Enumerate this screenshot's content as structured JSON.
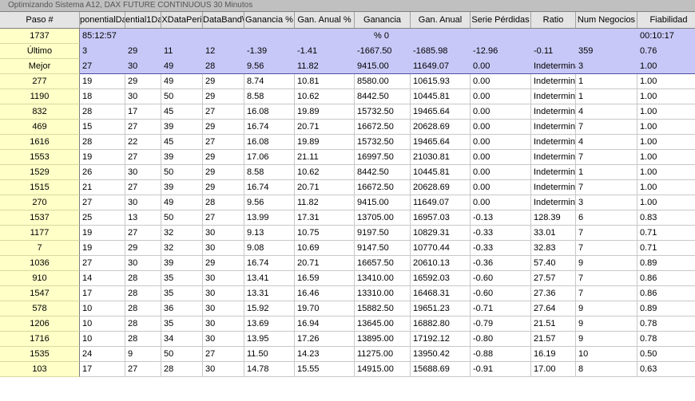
{
  "window": {
    "title": "Optimizando Sistema A12, DAX FUTURE CONTINUOUS 30 Minutos"
  },
  "headers": [
    "Paso #",
    "ponentialData",
    "ential1Da",
    "XDataPeri",
    "DataBand\\",
    "Ganancia %",
    "Gan. Anual %",
    "Ganancia",
    "Gan. Anual",
    "Serie Pérdidas",
    "Ratio",
    "Num Negocios",
    "Fiabilidad"
  ],
  "progress": {
    "label": "1737",
    "elapsed": "85:12:57",
    "percent": "% 0",
    "remaining": "00:10:17"
  },
  "summary": [
    {
      "label": "Último",
      "cells": [
        "3",
        "29",
        "11",
        "12",
        "-1.39",
        "-1.41",
        "-1667.50",
        "-1685.98",
        "-12.96",
        "-0.11",
        "359",
        "0.76"
      ]
    },
    {
      "label": "Mejor",
      "cells": [
        "27",
        "30",
        "49",
        "28",
        "9.56",
        "11.82",
        "9415.00",
        "11649.07",
        "0.00",
        "Indetermina",
        "3",
        "1.00"
      ]
    }
  ],
  "rows": [
    [
      "277",
      "19",
      "29",
      "49",
      "29",
      "8.74",
      "10.81",
      "8580.00",
      "10615.93",
      "0.00",
      "Indetermina",
      "1",
      "1.00"
    ],
    [
      "1190",
      "18",
      "30",
      "50",
      "29",
      "8.58",
      "10.62",
      "8442.50",
      "10445.81",
      "0.00",
      "Indetermina",
      "1",
      "1.00"
    ],
    [
      "832",
      "28",
      "17",
      "45",
      "27",
      "16.08",
      "19.89",
      "15732.50",
      "19465.64",
      "0.00",
      "Indetermina",
      "4",
      "1.00"
    ],
    [
      "469",
      "15",
      "27",
      "39",
      "29",
      "16.74",
      "20.71",
      "16672.50",
      "20628.69",
      "0.00",
      "Indetermina",
      "7",
      "1.00"
    ],
    [
      "1616",
      "28",
      "22",
      "45",
      "27",
      "16.08",
      "19.89",
      "15732.50",
      "19465.64",
      "0.00",
      "Indetermina",
      "4",
      "1.00"
    ],
    [
      "1553",
      "19",
      "27",
      "39",
      "29",
      "17.06",
      "21.11",
      "16997.50",
      "21030.81",
      "0.00",
      "Indetermina",
      "7",
      "1.00"
    ],
    [
      "1529",
      "26",
      "30",
      "50",
      "29",
      "8.58",
      "10.62",
      "8442.50",
      "10445.81",
      "0.00",
      "Indetermina",
      "1",
      "1.00"
    ],
    [
      "1515",
      "21",
      "27",
      "39",
      "29",
      "16.74",
      "20.71",
      "16672.50",
      "20628.69",
      "0.00",
      "Indetermina",
      "7",
      "1.00"
    ],
    [
      "270",
      "27",
      "30",
      "49",
      "28",
      "9.56",
      "11.82",
      "9415.00",
      "11649.07",
      "0.00",
      "Indetermina",
      "3",
      "1.00"
    ],
    [
      "1537",
      "25",
      "13",
      "50",
      "27",
      "13.99",
      "17.31",
      "13705.00",
      "16957.03",
      "-0.13",
      "128.39",
      "6",
      "0.83"
    ],
    [
      "1177",
      "19",
      "27",
      "32",
      "30",
      "9.13",
      "10.75",
      "9197.50",
      "10829.31",
      "-0.33",
      "33.01",
      "7",
      "0.71"
    ],
    [
      "7",
      "19",
      "29",
      "32",
      "30",
      "9.08",
      "10.69",
      "9147.50",
      "10770.44",
      "-0.33",
      "32.83",
      "7",
      "0.71"
    ],
    [
      "1036",
      "27",
      "30",
      "39",
      "29",
      "16.74",
      "20.71",
      "16657.50",
      "20610.13",
      "-0.36",
      "57.40",
      "9",
      "0.89"
    ],
    [
      "910",
      "14",
      "28",
      "35",
      "30",
      "13.41",
      "16.59",
      "13410.00",
      "16592.03",
      "-0.60",
      "27.57",
      "7",
      "0.86"
    ],
    [
      "1547",
      "17",
      "28",
      "35",
      "30",
      "13.31",
      "16.46",
      "13310.00",
      "16468.31",
      "-0.60",
      "27.36",
      "7",
      "0.86"
    ],
    [
      "578",
      "10",
      "28",
      "36",
      "30",
      "15.92",
      "19.70",
      "15882.50",
      "19651.23",
      "-0.71",
      "27.64",
      "9",
      "0.89"
    ],
    [
      "1206",
      "10",
      "28",
      "35",
      "30",
      "13.69",
      "16.94",
      "13645.00",
      "16882.80",
      "-0.79",
      "21.51",
      "9",
      "0.78"
    ],
    [
      "1716",
      "10",
      "28",
      "34",
      "30",
      "13.95",
      "17.26",
      "13895.00",
      "17192.12",
      "-0.80",
      "21.57",
      "9",
      "0.78"
    ],
    [
      "1535",
      "24",
      "9",
      "50",
      "27",
      "11.50",
      "14.23",
      "11275.00",
      "13950.42",
      "-0.88",
      "16.19",
      "10",
      "0.50"
    ],
    [
      "103",
      "17",
      "27",
      "28",
      "30",
      "14.78",
      "15.55",
      "14915.00",
      "15688.69",
      "-0.91",
      "17.00",
      "8",
      "0.63"
    ]
  ]
}
